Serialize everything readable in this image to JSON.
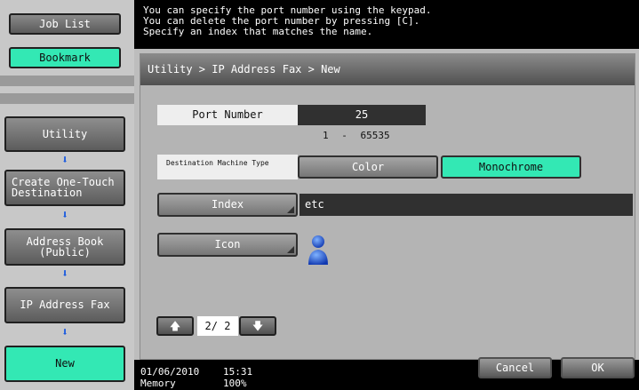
{
  "sidebar": {
    "job_list": "Job List",
    "bookmark": "Bookmark",
    "steps": [
      "Utility",
      "Create One-Touch\nDestination",
      "Address Book\n(Public)",
      "IP Address Fax",
      "New"
    ]
  },
  "message": {
    "lines": "You can specify the port number using the keypad.\nYou can delete the port number by pressing [C].\nSpecify an index that matches the name."
  },
  "breadcrumb": "Utility > IP Address Fax > New",
  "port": {
    "label": "Port Number",
    "value": "25",
    "range_min": "1",
    "range_sep": "-",
    "range_max": "65535"
  },
  "dest_type": {
    "label": "Destination Machine Type",
    "options": [
      "Color",
      "Monochrome"
    ],
    "selected": "Monochrome"
  },
  "index": {
    "button": "Index",
    "value": "etc"
  },
  "icon": {
    "button": "Icon",
    "glyph": "person-icon"
  },
  "pager": {
    "current": "2",
    "total": "2",
    "display": "2/ 2"
  },
  "status": {
    "date": "01/06/2010",
    "time": "15:31",
    "memory_label": "Memory",
    "memory_value": "100%"
  },
  "footer": {
    "cancel": "Cancel",
    "ok": "OK"
  },
  "colors": {
    "accent": "#33e8b4",
    "arrow": "#1a5adf"
  }
}
